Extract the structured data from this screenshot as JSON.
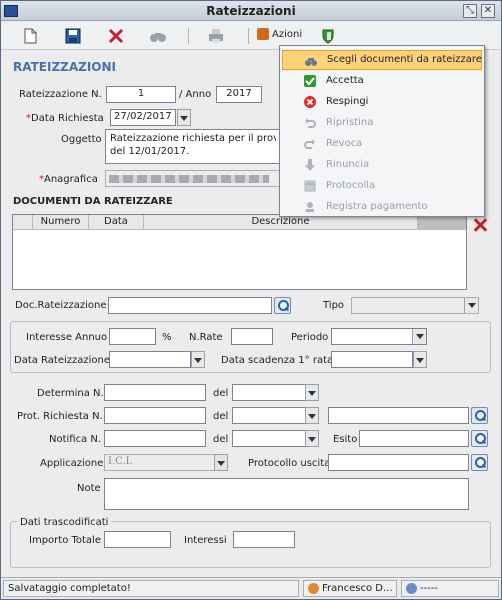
{
  "window": {
    "title": "Rateizzazioni"
  },
  "toolbar": {
    "actions_label": "Azioni"
  },
  "header": {
    "section_title": "RATEIZZAZIONI"
  },
  "form": {
    "rateizzazione_label": "Rateizzazione N.",
    "rateizzazione_value": "1",
    "anno_label": "/ Anno",
    "anno_value": "2017",
    "data_richiesta_label": "Data Richiesta",
    "data_richiesta_value": "27/02/2017",
    "oggetto_label": "Oggetto",
    "oggetto_value_line1": "Rateizzazione richiesta per il provved",
    "oggetto_value_line2": "del 12/01/2017.",
    "anagrafica_label": "Anagrafica",
    "required_mark": "*"
  },
  "documents": {
    "section_title": "DOCUMENTI DA RATEIZZARE",
    "columns": [
      "Numero",
      "Data",
      "Descrizione"
    ]
  },
  "doc_rate": {
    "label": "Doc.Rateizzazione",
    "tipo_label": "Tipo"
  },
  "plan": {
    "interesse_label": "Interesse Annuo",
    "percent": "%",
    "nrate_label": "N.Rate",
    "periodo_label": "Periodo",
    "data_rate_label": "Data Rateizzazione",
    "data_scadenza_label": "Data scadenza 1° rata"
  },
  "atti": {
    "determina_label": "Determina N.",
    "del_label": "del",
    "prot_label": "Prot. Richiesta N.",
    "notifica_label": "Notifica N.",
    "esito_label": "Esito",
    "applicazione_label": "Applicazione",
    "applicazione_value": "I.C.I.",
    "protocollo_label": "Protocollo uscita",
    "note_label": "Note"
  },
  "dati": {
    "group_title": "Dati trascodificati",
    "importo_label": "Importo Totale",
    "interessi_label": "Interessi"
  },
  "menu": {
    "items": [
      {
        "label": "Scegli documenti da rateizzare",
        "icon": "binoculars-icon",
        "color": "#6a7a8a",
        "state": "highlighted"
      },
      {
        "label": "Accetta",
        "icon": "check-icon",
        "color": "#2f9a2f",
        "state": "enabled"
      },
      {
        "label": "Respingi",
        "icon": "reject-icon",
        "color": "#d8302a",
        "state": "enabled"
      },
      {
        "label": "Ripristina",
        "icon": "undo-icon",
        "color": "#b0b4ba",
        "state": "disabled"
      },
      {
        "label": "Revoca",
        "icon": "revoke-icon",
        "color": "#b0b4ba",
        "state": "disabled"
      },
      {
        "label": "Rinuncia",
        "icon": "down-arrow-icon",
        "color": "#b0b4ba",
        "state": "disabled"
      },
      {
        "label": "Protocolla",
        "icon": "protocol-icon",
        "color": "#b0b4ba",
        "state": "disabled"
      },
      {
        "label": "Registra pagamento",
        "icon": "payment-icon",
        "color": "#b0b4ba",
        "state": "disabled"
      }
    ]
  },
  "status": {
    "message": "Salvataggio completato!",
    "user": "Francesco D...",
    "extra": "-----"
  },
  "colors": {
    "accent": "#4a6fb5",
    "required": "#c8202a",
    "highlight": "#ffd37a"
  }
}
